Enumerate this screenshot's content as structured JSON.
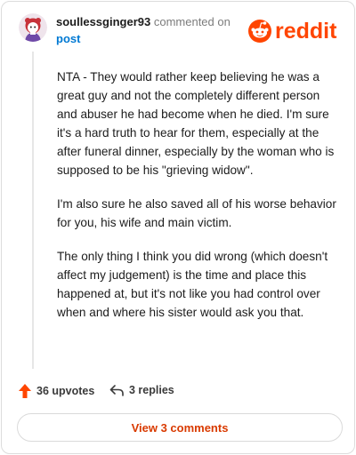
{
  "comment": {
    "author": "soullessginger93",
    "action": "commented on",
    "target": "post",
    "paragraphs": [
      "NTA - They would rather keep believing he was a great guy and not the completely different person and abuser he had become when he died. I'm sure it's a hard truth to hear for them, especially at the after funeral dinner, especially by the woman who is supposed to be his \"grieving widow\".",
      "I'm also sure he also saved all of his worse behavior for you, his wife and main victim.",
      "The only thing I think you did wrong (which doesn't affect my judgement) is the time and place this happened at, but it's not like you had control over when and where his sister would ask you that."
    ]
  },
  "brand": {
    "name": "reddit",
    "color": "#ff4500"
  },
  "actions": {
    "upvotes": "36 upvotes",
    "replies": "3 replies",
    "view_comments": "View 3 comments"
  },
  "icons": {
    "avatar": "avatar-icon",
    "upvote": "upvote-arrow-icon",
    "reply": "reply-arrow-icon",
    "logo": "reddit-snoo-icon"
  }
}
